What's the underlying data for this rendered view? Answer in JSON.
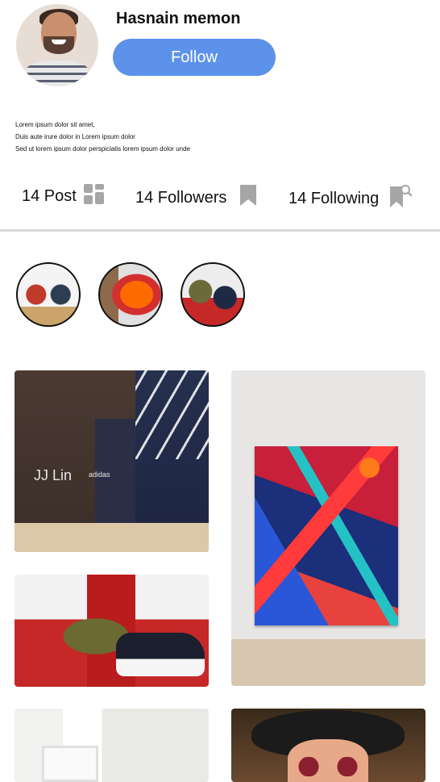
{
  "profile": {
    "name": "Hasnain memon",
    "follow_label": "Follow",
    "bio": [
      "Lorem ipsum dolor sit amet,",
      "Duis aute irure dolor in Lorem ipsum dolor",
      "Sed ut lorem ipsum dolor  perspiciatis lorem ipsum dolor  unde"
    ]
  },
  "stats": {
    "posts": "14 Post",
    "followers": "14 Followers",
    "following": "14 Following"
  },
  "highlights": [
    {
      "icon": "highlight-art-masks"
    },
    {
      "icon": "highlight-orange-painting"
    },
    {
      "icon": "highlight-cap-sneakers"
    }
  ],
  "grid": {
    "tile1": {
      "label": "JJ Lin",
      "brand": "adidas"
    }
  },
  "colors": {
    "accent": "#5c92ea",
    "divider": "#d9d9d9",
    "icon_gray": "#a6a6a6"
  }
}
